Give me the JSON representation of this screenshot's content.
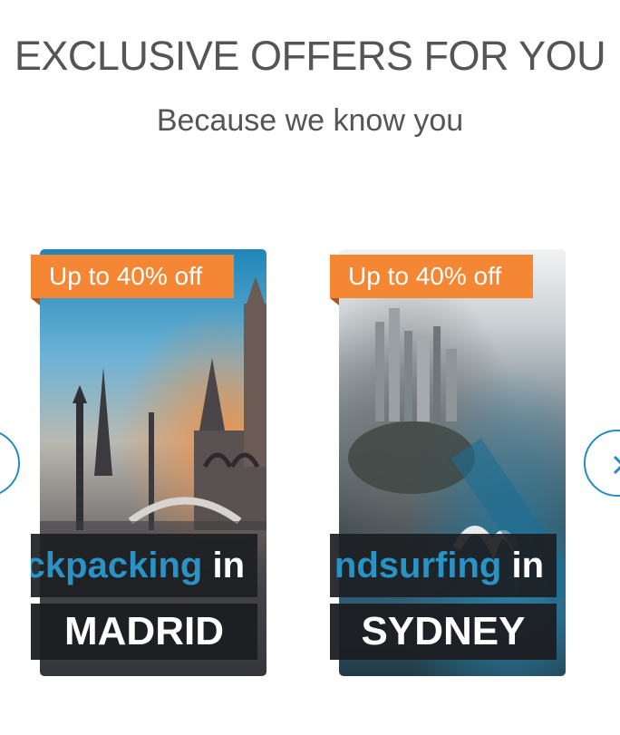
{
  "header": {
    "title": "EXCLUSIVE OFFERS FOR YOU",
    "subtitle": "Because we know you"
  },
  "offers": [
    {
      "badge": "Up to 40% off",
      "activity": "ckpacking",
      "connector": "in",
      "city": "MADRID"
    },
    {
      "badge": "Up to 40% off",
      "activity": "ndsurfing",
      "connector": "in",
      "city": "SYDNEY"
    }
  ],
  "carousel": {
    "prev_icon": "chevron-left-icon",
    "next_icon": "chevron-right-icon"
  },
  "colors": {
    "badge": "#f58634",
    "activity": "#2a93c6",
    "accent": "#1f8fbf",
    "text": "#555555"
  }
}
